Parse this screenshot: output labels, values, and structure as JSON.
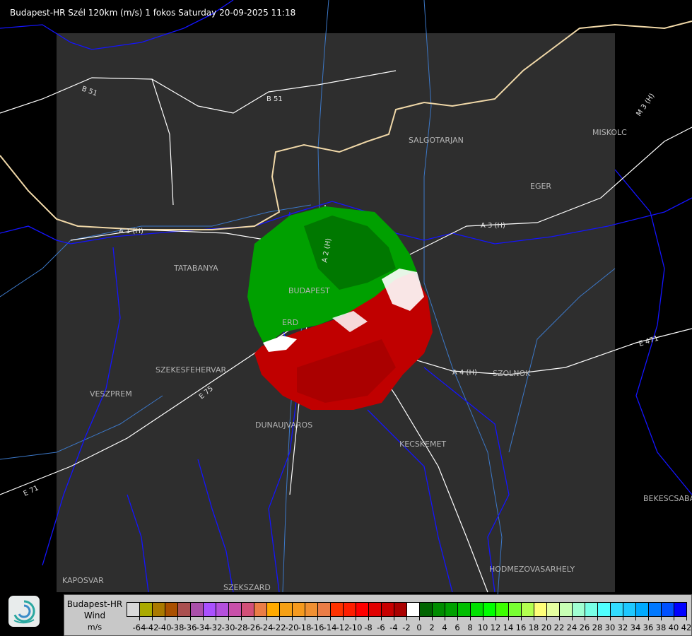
{
  "header": {
    "title": "Budapest-HR Szél 120km (m/s) 1 fokos Saturday 20-09-2025 11:18"
  },
  "map": {
    "cities": [
      "SALGOTARJAN",
      "MISKOLC",
      "EGER",
      "TATABANYA",
      "BUDAPEST",
      "ERD",
      "SZEKESFEHERVAR",
      "VESZPREM",
      "DUNAUJVAROS",
      "KECSKEMET",
      "SZOLNOK",
      "BEKESCSABA",
      "HODMEZOVASARHELY",
      "KAPOSVAR",
      "SZEKSZARD"
    ],
    "roads": [
      "B 51",
      "B 51",
      "A 3 (H)",
      "A 1 (H)",
      "A 4 (H)",
      "E 471",
      "E 71",
      "A 2 (H)",
      "M 3 (H)",
      "E 75"
    ],
    "colors": {
      "background": "#000000",
      "radar_area": "#2e2e2e",
      "border": "#1414ff",
      "river": "#3c78c8",
      "road": "#ffffff",
      "approaching": "#00a000",
      "receding": "#c00000"
    }
  },
  "legend": {
    "station": "Budapest-HR",
    "quantity": "Wind",
    "unit": "m/s",
    "labels": [
      "-64",
      "-42",
      "-40",
      "-38",
      "-36",
      "-34",
      "-32",
      "-30",
      "-28",
      "-26",
      "-24",
      "-22",
      "-20",
      "-18",
      "-16",
      "-14",
      "-12",
      "-10",
      "-8",
      "-6",
      "-4",
      "-2",
      "0",
      "2",
      "4",
      "6",
      "8",
      "10",
      "12",
      "14",
      "16",
      "18",
      "20",
      "22",
      "24",
      "26",
      "28",
      "30",
      "32",
      "34",
      "36",
      "38",
      "40",
      "42"
    ],
    "colors": [
      "#d8d8d8",
      "#aaaa00",
      "#aa7a00",
      "#aa5000",
      "#aa5050",
      "#aa50aa",
      "#aa50ff",
      "#b450dc",
      "#c850aa",
      "#d25078",
      "#eb7d46",
      "#ffaa00",
      "#f5a014",
      "#f59a1e",
      "#f09032",
      "#eb7d46",
      "#ff3200",
      "#ff1e00",
      "#ff0000",
      "#e00000",
      "#c80000",
      "#aa0000",
      "#ffffff",
      "#006400",
      "#008c00",
      "#00a000",
      "#00be00",
      "#00e100",
      "#00ff00",
      "#3cff00",
      "#78ff32",
      "#b4ff50",
      "#ffff78",
      "#e6ffa0",
      "#c8ffb4",
      "#a0ffd2",
      "#78ffe6",
      "#50ffff",
      "#32dcff",
      "#1ec8ff",
      "#00aaff",
      "#0078ff",
      "#0050ff",
      "#0000ff"
    ]
  }
}
